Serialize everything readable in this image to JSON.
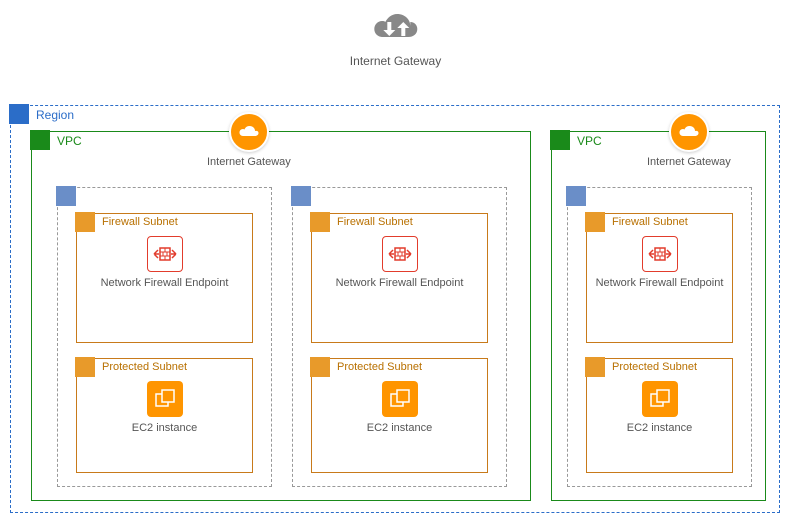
{
  "top_gateway": {
    "label": "Internet Gateway"
  },
  "region": {
    "label": "Region"
  },
  "vpc_label": "VPC",
  "vpc_igw_label": "Internet Gateway",
  "subnets": {
    "firewall": {
      "label": "Firewall Subnet",
      "resource": "Network Firewall Endpoint"
    },
    "protected": {
      "label": "Protected Subnet",
      "resource": "EC2 instance"
    }
  },
  "layout": {
    "vpcs": [
      {
        "id": "vpc-1",
        "azs": 2
      },
      {
        "id": "vpc-2",
        "azs": 1
      }
    ]
  },
  "colors": {
    "region": "#2b6dc8",
    "vpc": "#1a8a1a",
    "subnet": "#c87a1a",
    "orange": "#ff9500",
    "firewall": "#e23c2c"
  }
}
